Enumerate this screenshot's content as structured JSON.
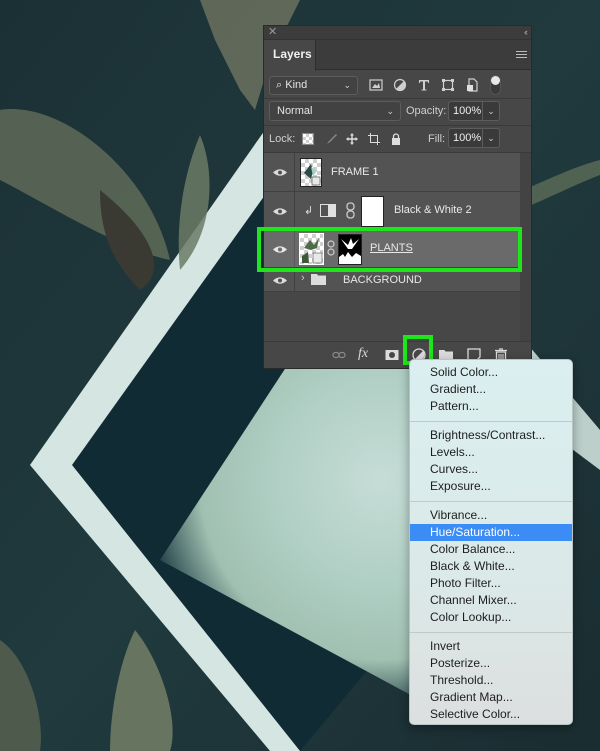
{
  "panel": {
    "title": "Layers",
    "close_icon": "close-icon",
    "collapse_icon": "double-chevron-left-icon",
    "menu_icon": "hamburger-menu-icon",
    "filter": {
      "kind_label": "Kind",
      "kind_icon": "search-icon",
      "filter_icons": [
        "image-filter-icon",
        "adjustment-filter-icon",
        "type-filter-icon",
        "shape-filter-icon",
        "smart-object-filter-icon"
      ],
      "toggle_on": true
    },
    "blend_mode": "Normal",
    "opacity_label": "Opacity:",
    "opacity_value": "100%",
    "lock_label": "Lock:",
    "lock_icons": [
      "lock-transparent-pixels-icon",
      "lock-image-pixels-icon",
      "lock-position-icon",
      "lock-artboard-icon",
      "lock-all-icon"
    ],
    "fill_label": "Fill:",
    "fill_value": "100%",
    "layers": [
      {
        "name": "FRAME 1",
        "visible": true,
        "type": "smart-object",
        "selected": false
      },
      {
        "name": "Black & White 2",
        "visible": true,
        "type": "adjustment",
        "clipped": true,
        "selected": false
      },
      {
        "name": "PLANTS",
        "visible": true,
        "type": "smart-object-with-mask",
        "selected": true
      },
      {
        "name": "BACKGROUND",
        "visible": true,
        "type": "group",
        "collapsed": true,
        "selected": false
      }
    ],
    "bottom_icons": [
      "link-layers-icon",
      "fx-icon",
      "add-mask-icon",
      "new-adjustment-layer-icon",
      "new-group-icon",
      "new-layer-icon",
      "delete-icon"
    ],
    "fx_label": "fx"
  },
  "highlight_color": "#1ee61a",
  "dropdown": {
    "groups": [
      [
        "Solid Color...",
        "Gradient...",
        "Pattern..."
      ],
      [
        "Brightness/Contrast...",
        "Levels...",
        "Curves...",
        "Exposure..."
      ],
      [
        "Vibrance...",
        "Hue/Saturation...",
        "Color Balance...",
        "Black & White...",
        "Photo Filter...",
        "Channel Mixer...",
        "Color Lookup..."
      ],
      [
        "Invert",
        "Posterize...",
        "Threshold...",
        "Gradient Map...",
        "Selective Color..."
      ]
    ],
    "active_item": "Hue/Saturation...",
    "active_color": "#3c8cf5"
  }
}
